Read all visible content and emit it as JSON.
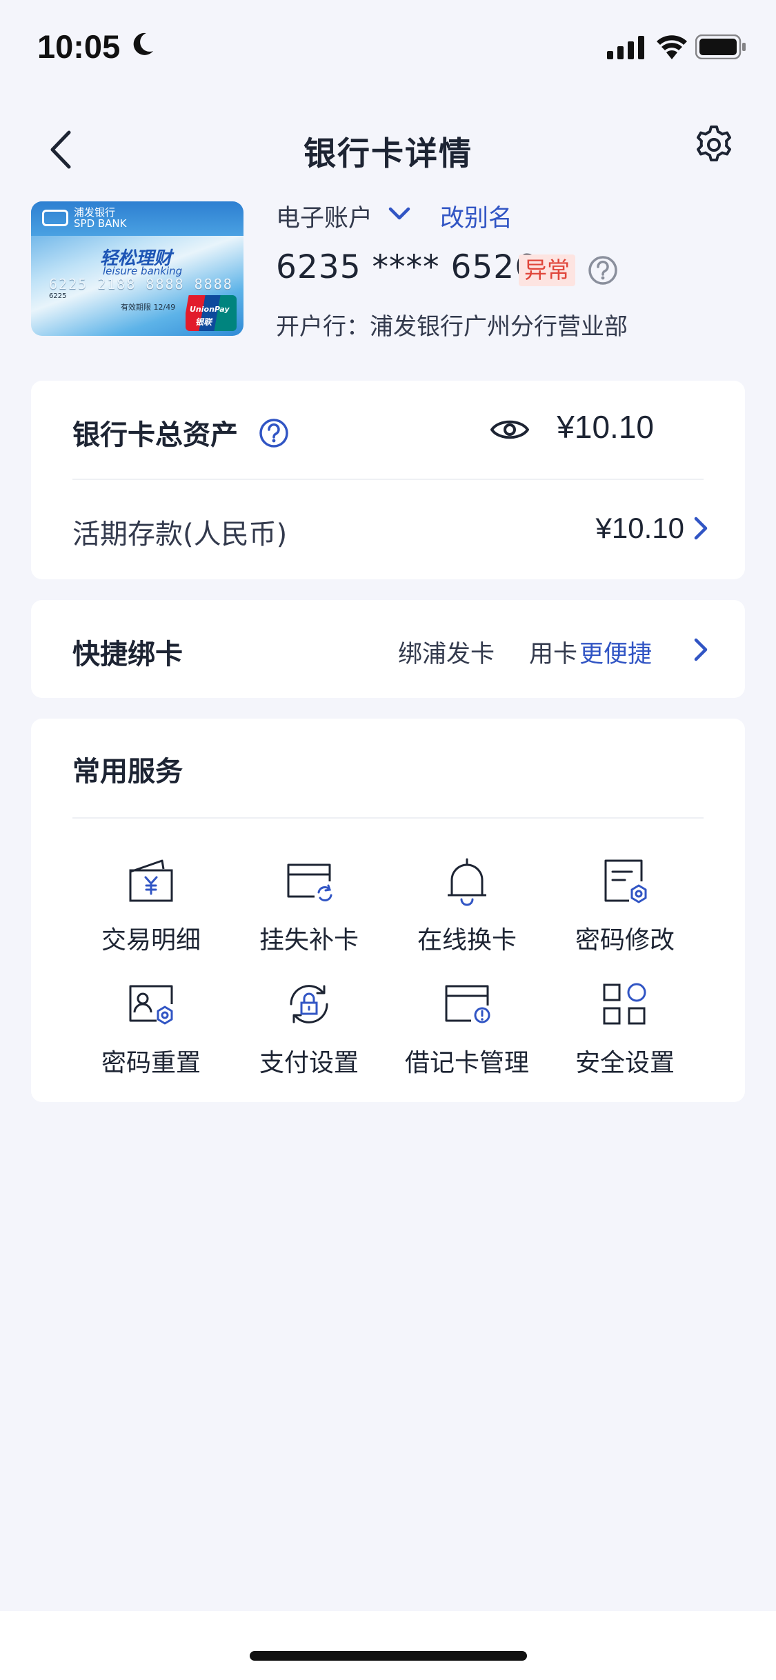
{
  "status_bar": {
    "time": "10:05"
  },
  "nav": {
    "title": "银行卡详情"
  },
  "card": {
    "image": {
      "bank_logo_text_cn": "浦发银行",
      "bank_logo_text_en": "SPD BANK",
      "brand_cn": "轻松理财",
      "brand_en": "leisure banking",
      "digits": "6225 2188 8888 8888",
      "small_digits": "6225",
      "expiry": "有效期限 12/49",
      "unionpay_en": "UnionPay",
      "unionpay_cn": "银联"
    },
    "account_type": "电子账户",
    "rename_label": "改别名",
    "number": "6235 **** 6526",
    "status_badge": "异常",
    "branch": "开户行：浦发银行广州分行营业部"
  },
  "assets": {
    "total_label": "银行卡总资产",
    "total_value": "¥10.10",
    "demand_label": "活期存款(人民币)",
    "demand_value": "¥10.10"
  },
  "quick_bind": {
    "title": "快捷绑卡",
    "text_a": "绑浦发卡",
    "text_b": "用卡",
    "text_c": "更便捷"
  },
  "services": {
    "title": "常用服务",
    "items": [
      {
        "label": "交易明细",
        "icon": "wallet-yen-icon"
      },
      {
        "label": "挂失补卡",
        "icon": "card-refresh-icon"
      },
      {
        "label": "在线换卡",
        "icon": "bell-icon"
      },
      {
        "label": "密码修改",
        "icon": "doc-hex-icon"
      },
      {
        "label": "密码重置",
        "icon": "id-card-hex-icon"
      },
      {
        "label": "支付设置",
        "icon": "lock-cycle-icon"
      },
      {
        "label": "借记卡管理",
        "icon": "card-alert-icon"
      },
      {
        "label": "安全设置",
        "icon": "grid-circle-icon"
      }
    ]
  },
  "colors": {
    "accent": "#3155c4",
    "danger": "#e0463a",
    "badge_bg": "#fde4e1",
    "page_bg": "#f4f5fb"
  }
}
